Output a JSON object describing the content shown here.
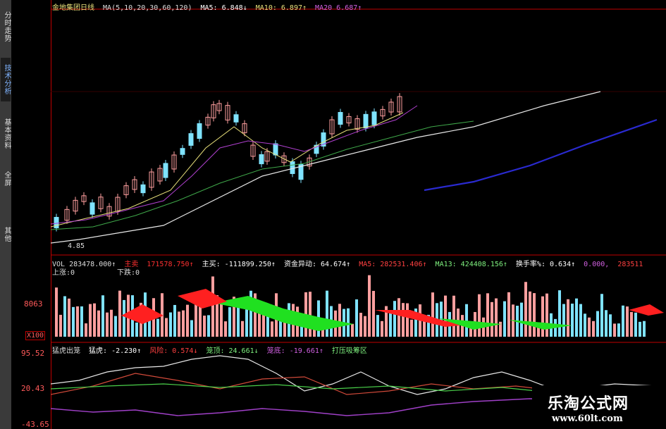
{
  "sidebar": {
    "tabs": [
      {
        "label": "分时走势",
        "active": false
      },
      {
        "label": "技术分析",
        "active": true
      },
      {
        "label": "基本资料",
        "active": false
      },
      {
        "label": "全屏",
        "active": false
      },
      {
        "label": "其他",
        "active": false
      }
    ]
  },
  "header": {
    "stock": "金地集团日线",
    "ma_params": "MA(5,10,20,30,60,120)",
    "ma5": "MA5: 6.848↓",
    "ma10": "MA10: 6.897↑",
    "ma20": "MA20  6.687↑"
  },
  "price_panel": {
    "low_label": "4.85"
  },
  "volume_panel": {
    "vol": "VOL 283478.000↑",
    "main_sell_label": "主卖",
    "main_sell_value": "171578.750↑",
    "main_buy": "主买: -111899.250↑",
    "fund_move": "资金异动: 64.674↑",
    "ma5": "MA5: 282531.406↑",
    "ma13": "MA13: 424408.156↑",
    "turnover": "换手率%: 0.634↑",
    "extra1": "0.000,",
    "extra2": "283511",
    "up_label": "上涨:0",
    "down_label": "下跌:0",
    "axis_top": "8063",
    "axis_unit": "X100"
  },
  "indicator_panel": {
    "name": "猛虎出笼",
    "tiger": "猛虎: -2.230↑",
    "wind": "风险: 0.574↓",
    "cage": "笼顶: 24.661↓",
    "cage_bottom": "笼底: -19.661↑",
    "zone": "打压吸筹区",
    "axis_top": "95.52",
    "axis_mid": "20.43",
    "axis_bot": "-43.65"
  },
  "watermark": {
    "title": "乐淘公式网",
    "url": "www.60lt.com"
  },
  "colors": {
    "up": "#ff9f9f",
    "down": "#7fe3ff",
    "ma_white": "#e8e8e8",
    "ma_yellow": "#e8e07a",
    "ma_purple": "#b040d0",
    "ma_green": "#3fa84a",
    "ma_blue": "#2a2ad0",
    "border": "#c00000"
  }
}
